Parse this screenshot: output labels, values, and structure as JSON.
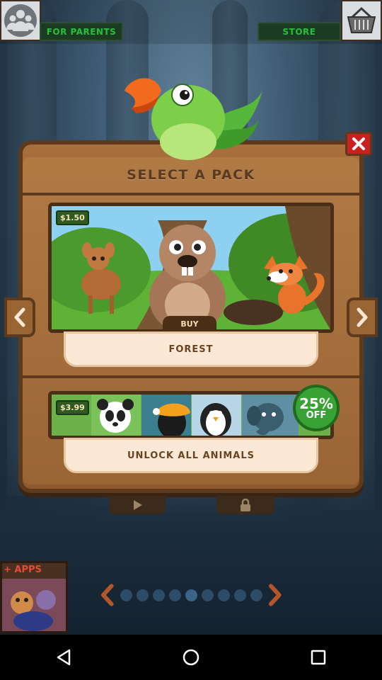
{
  "topbar": {
    "for_parents_label": "FOR PARENTS",
    "store_label": "STORE",
    "profile_icon": "family-icon",
    "basket_icon": "basket-icon"
  },
  "dialog": {
    "title": "SELECT A PACK",
    "close_icon": "close-icon",
    "prev_icon": "chevron-left-icon",
    "next_icon": "chevron-right-icon",
    "mascot": "parrot"
  },
  "packs": [
    {
      "price": "$1.50",
      "buy_label": "BUY",
      "name": "FOREST",
      "animals": [
        "deer",
        "beaver",
        "fox"
      ]
    },
    {
      "price": "$3.99",
      "name": "UNLOCK ALL ANIMALS",
      "animals": [
        "panda",
        "toucan",
        "penguin",
        "elephant"
      ],
      "discount": {
        "value": "25%",
        "text": "OFF"
      }
    }
  ],
  "controls": {
    "play_icon": "play-icon",
    "lock_icon": "lock-icon"
  },
  "pager": {
    "total": 9,
    "active_index": 4
  },
  "apps_promo": {
    "label": "+ APPS"
  },
  "colors": {
    "wood": "#9a6535",
    "wood_dark": "#5e3a1c",
    "green_text": "#27c03c",
    "close": "#c92020",
    "badge": "#38a334"
  },
  "navbar": {
    "back_icon": "back-icon",
    "home_icon": "home-icon",
    "recents_icon": "recents-icon"
  }
}
